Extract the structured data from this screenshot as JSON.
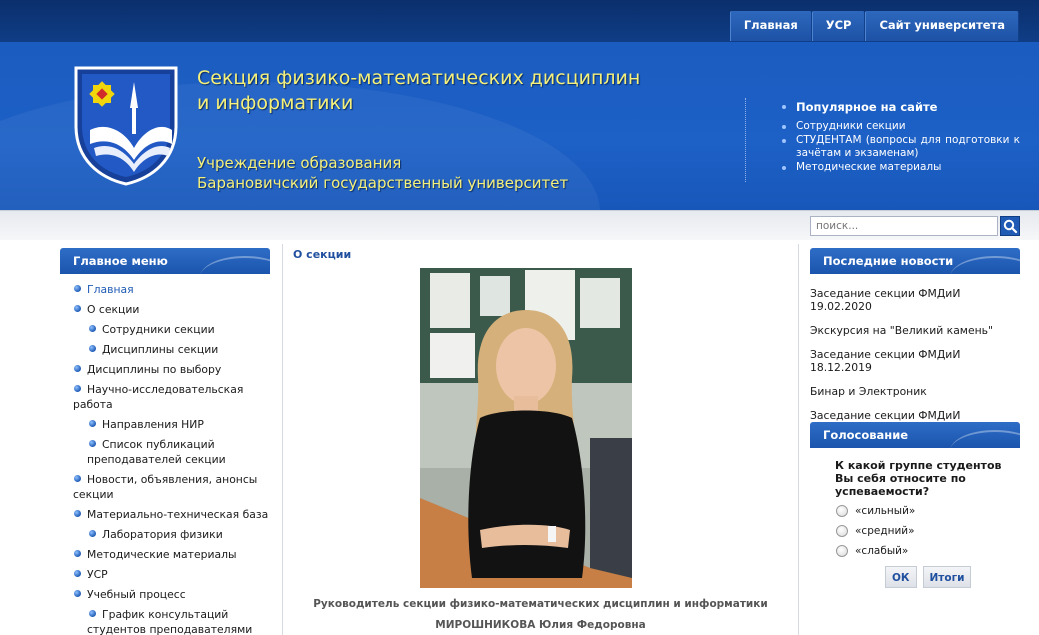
{
  "top_nav": [
    "Главная",
    "УСР",
    "Сайт университета"
  ],
  "header": {
    "title_line1": "Секция физико-математических дисциплин",
    "title_line2": "и информатики",
    "subtitle_line1": "Учреждение образования",
    "subtitle_line2": "Барановичский государственный университет"
  },
  "popular": {
    "title": "Популярное на сайте",
    "items": [
      "Сотрудники секции",
      "СТУДЕНТАМ (вопросы для подготовки к зачётам и экзаменам)",
      "Методические материалы"
    ]
  },
  "search": {
    "placeholder": "поиск..."
  },
  "main_menu": {
    "title": "Главное меню",
    "items": [
      "Главная",
      "О секции",
      "Сотрудники секции",
      "Дисциплины секции",
      "Дисциплины по выбору",
      "Научно-исследовательская работа",
      "Направления НИР",
      "Список публикаций преподавателей секции",
      "Новости, объявления, анонсы секции",
      "Материально-техническая база",
      "Лаборатория физики",
      "Методические материалы",
      "УСР",
      "Учебный процесс",
      "График консультаций студентов преподавателями"
    ]
  },
  "content": {
    "breadcrumb": "О секции",
    "caption_line1": "Руководитель секции физико-математических дисциплин и информатики",
    "caption_line2": "МИРОШНИКОВА Юлия Федоровна"
  },
  "news": {
    "title": "Последние новости",
    "items": [
      "Заседание секции ФМДиИ 19.02.2020",
      "Экскурсия на \"Великий камень\"",
      "Заседание секции ФМДиИ 18.12.2019",
      "Бинар и Электроник",
      "Заседание секции ФМДиИ"
    ]
  },
  "poll": {
    "title": "Голосование",
    "question": "К какой группе студентов Вы себя относите по успеваемости?",
    "options": [
      "«сильный»",
      "«средний»",
      "«слабый»"
    ],
    "vote_label": "ОК",
    "results_label": "Итоги"
  },
  "colors": {
    "brand_blue": "#1b5cc0",
    "title_yellow": "#f5f07a",
    "link_blue": "#1f5bb5"
  }
}
